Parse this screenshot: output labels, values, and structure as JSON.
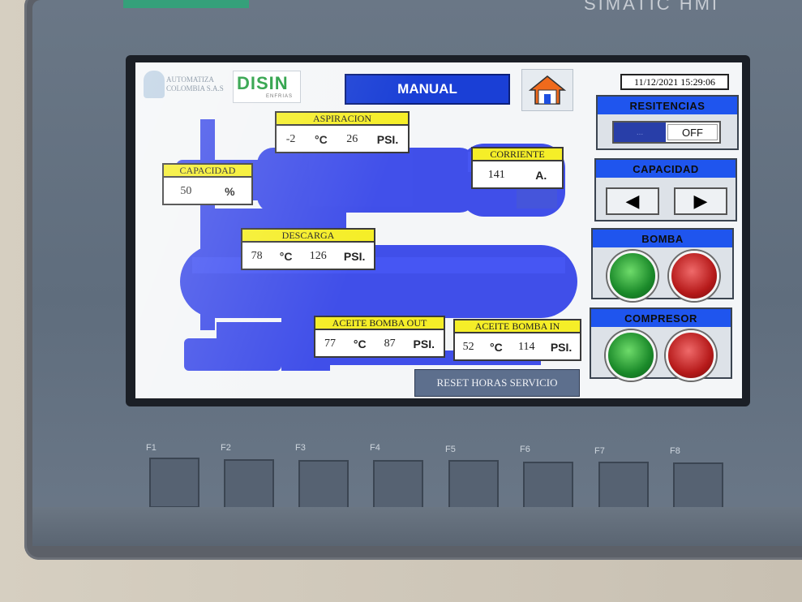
{
  "brand": {
    "bezel_text": "SIMATIC HMI"
  },
  "header": {
    "logo_automatiza": "AUTOMATIZA COLOMBIA S.A.S",
    "logo_disin": "DISIN",
    "logo_disin_sub": "ENFRIAS",
    "mode_label": "MANUAL",
    "home_icon": "home-icon",
    "datetime": "11/12/2021 15:29:06"
  },
  "readouts": {
    "aspiracion": {
      "label": "ASPIRACION",
      "temp": "-2",
      "temp_unit": "°C",
      "pressure": "26",
      "pressure_unit": "PSI."
    },
    "corriente": {
      "label": "CORRIENTE",
      "value": "141",
      "unit": "A."
    },
    "capacidad": {
      "label": "CAPACIDAD",
      "value": "50",
      "unit": "%"
    },
    "descarga": {
      "label": "DESCARGA",
      "temp": "78",
      "temp_unit": "°C",
      "pressure": "126",
      "pressure_unit": "PSI."
    },
    "aceite_out": {
      "label": "ACEITE BOMBA OUT",
      "temp": "77",
      "temp_unit": "°C",
      "pressure": "87",
      "pressure_unit": "PSI."
    },
    "aceite_in": {
      "label": "ACEITE BOMBA IN",
      "temp": "52",
      "temp_unit": "°C",
      "pressure": "114",
      "pressure_unit": "PSI."
    }
  },
  "panels": {
    "resistencias": {
      "title": "RESITENCIAS",
      "on_label": "...",
      "off_label": "OFF"
    },
    "capacidad": {
      "title": "CAPACIDAD",
      "left_icon": "◀",
      "right_icon": "▶"
    },
    "bomba": {
      "title": "BOMBA"
    },
    "compresor": {
      "title": "COMPRESOR"
    }
  },
  "reset_button": "RESET HORAS SERVICIO",
  "function_keys": [
    "F1",
    "F2",
    "F3",
    "F4",
    "F5",
    "F6",
    "F7",
    "F8"
  ],
  "colors": {
    "accent_blue": "#1f55ee",
    "label_yellow": "#f5ee28",
    "run_green": "#1b8a2a",
    "stop_red": "#b61a1a"
  }
}
